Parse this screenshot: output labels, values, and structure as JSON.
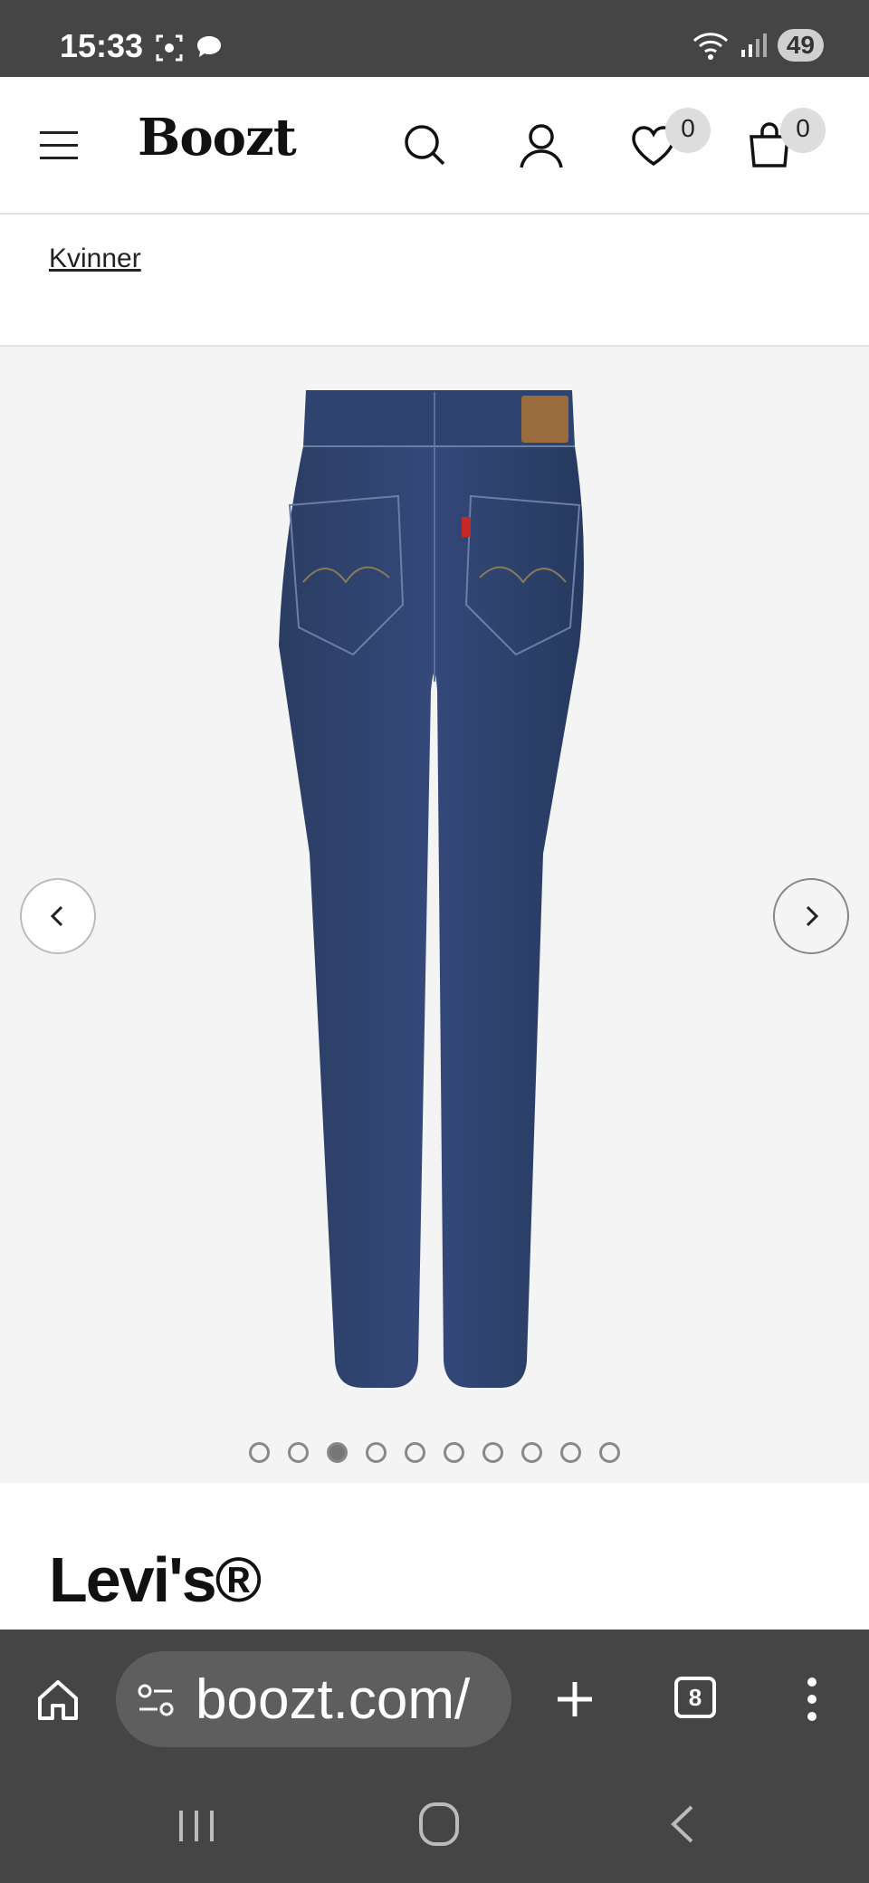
{
  "status_bar": {
    "time": "15:33",
    "battery": "49"
  },
  "header": {
    "logo": "Boozt",
    "wishlist_count": "0",
    "cart_count": "0"
  },
  "breadcrumb": {
    "label": "Kvinner"
  },
  "gallery": {
    "image_count": 10,
    "active_index": 2
  },
  "product": {
    "brand": "Levi's®"
  },
  "browser": {
    "url": "boozt.com/",
    "tab_count": "8"
  }
}
